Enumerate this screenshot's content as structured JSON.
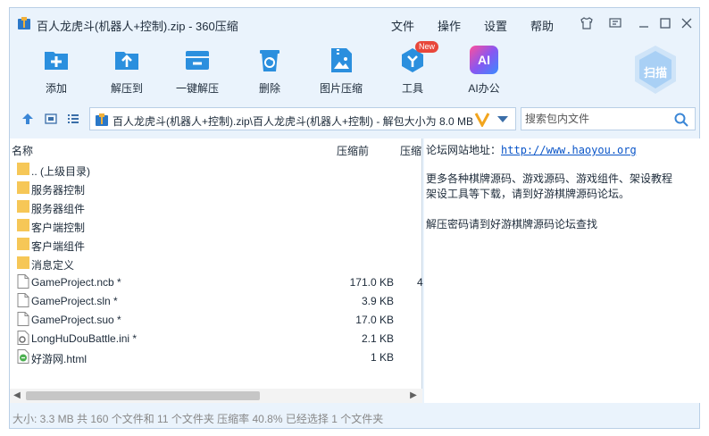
{
  "window": {
    "title": "百人龙虎斗(机器人+控制).zip - 360压缩",
    "menu": [
      "文件",
      "操作",
      "设置",
      "帮助"
    ]
  },
  "toolbar": {
    "items": [
      {
        "label": "添加",
        "icon": "add-icon"
      },
      {
        "label": "解压到",
        "icon": "extract-to-icon"
      },
      {
        "label": "一键解压",
        "icon": "one-click-extract-icon"
      },
      {
        "label": "删除",
        "icon": "recycle-delete-icon"
      },
      {
        "label": "图片压缩",
        "icon": "image-compress-icon"
      },
      {
        "label": "工具",
        "icon": "tools-icon",
        "badge": "New"
      },
      {
        "label": "AI办公",
        "icon": "ai-office-icon",
        "icon_text": "AI"
      }
    ],
    "scan_label": "扫描"
  },
  "address": {
    "path": "百人龙虎斗(机器人+控制).zip\\百人龙虎斗(机器人+控制) - 解包大小为 8.0 MB",
    "search_placeholder": "搜索包内文件"
  },
  "file_list": {
    "columns": [
      "名称",
      "压缩前",
      "压缩"
    ],
    "rows": [
      {
        "name": ".. (上级目录)",
        "type": "folder",
        "size": "",
        "packed": ""
      },
      {
        "name": "服务器控制",
        "type": "folder",
        "size": "",
        "packed": ""
      },
      {
        "name": "服务器组件",
        "type": "folder",
        "size": "",
        "packed": ""
      },
      {
        "name": "客户端控制",
        "type": "folder",
        "size": "",
        "packed": ""
      },
      {
        "name": "客户端组件",
        "type": "folder",
        "size": "",
        "packed": ""
      },
      {
        "name": "消息定义",
        "type": "folder",
        "size": "",
        "packed": ""
      },
      {
        "name": "GameProject.ncb *",
        "type": "file",
        "size": "171.0 KB",
        "packed": "4"
      },
      {
        "name": "GameProject.sln *",
        "type": "file",
        "size": "3.9 KB",
        "packed": ""
      },
      {
        "name": "GameProject.suo *",
        "type": "file",
        "size": "17.0 KB",
        "packed": ""
      },
      {
        "name": "LongHuDouBattle.ini *",
        "type": "ini",
        "size": "2.1 KB",
        "packed": ""
      },
      {
        "name": "好游网.html",
        "type": "html",
        "size": "1 KB",
        "packed": ""
      }
    ]
  },
  "comment": {
    "url_label": "论坛网站地址：",
    "url": "http://www.haoyou.org",
    "line2": "更多各种棋牌源码、游戏源码、游戏组件、架设教程",
    "line3": "架设工具等下载，请到好游棋牌源码论坛。",
    "line4": "解压密码请到好游棋牌源码论坛查找"
  },
  "status": {
    "text": "大小: 3.3 MB 共 160 个文件和 11 个文件夹 压缩率 40.8% 已经选择 1 个文件夹"
  },
  "colors": {
    "accent": "#2b8fde",
    "window_bg": "#eaf3fc",
    "folder": "#f6c757",
    "link": "#0a55c8",
    "badge": "#e8473b"
  }
}
